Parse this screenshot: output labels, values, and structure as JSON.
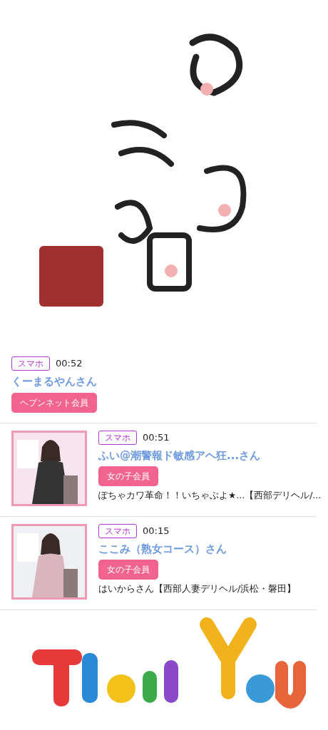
{
  "visitors": [
    {
      "device": "スマホ",
      "time": "00:52",
      "name": "くーまるやんさん",
      "member_type": "ヘブンネット会員",
      "photo": false
    },
    {
      "device": "スマホ",
      "time": "00:51",
      "name": "ふい@潮警報ド敏感アヘ狂...さん",
      "member_type": "女の子会員",
      "photo": true,
      "shop": "ぽちゃカワ革命！！いちゃぶよ★...【西部デリヘル/..."
    },
    {
      "device": "スマホ",
      "time": "00:15",
      "name": "ここみ（熟女コース）さん",
      "member_type": "女の子会員",
      "photo": true,
      "shop": "はいからさん【西部人妻デリヘル/浜松・磐田】"
    }
  ]
}
